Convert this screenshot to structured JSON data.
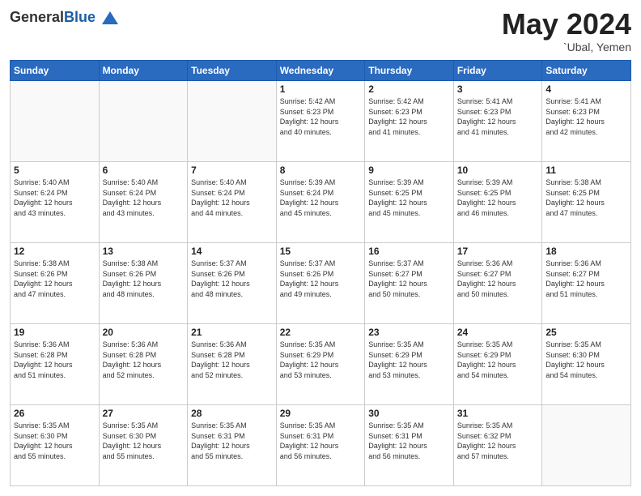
{
  "header": {
    "logo_general": "General",
    "logo_blue": "Blue",
    "month_title": "May 2024",
    "location": "`Ubal, Yemen"
  },
  "weekdays": [
    "Sunday",
    "Monday",
    "Tuesday",
    "Wednesday",
    "Thursday",
    "Friday",
    "Saturday"
  ],
  "weeks": [
    [
      {
        "day": "",
        "info": ""
      },
      {
        "day": "",
        "info": ""
      },
      {
        "day": "",
        "info": ""
      },
      {
        "day": "1",
        "info": "Sunrise: 5:42 AM\nSunset: 6:23 PM\nDaylight: 12 hours\nand 40 minutes."
      },
      {
        "day": "2",
        "info": "Sunrise: 5:42 AM\nSunset: 6:23 PM\nDaylight: 12 hours\nand 41 minutes."
      },
      {
        "day": "3",
        "info": "Sunrise: 5:41 AM\nSunset: 6:23 PM\nDaylight: 12 hours\nand 41 minutes."
      },
      {
        "day": "4",
        "info": "Sunrise: 5:41 AM\nSunset: 6:23 PM\nDaylight: 12 hours\nand 42 minutes."
      }
    ],
    [
      {
        "day": "5",
        "info": "Sunrise: 5:40 AM\nSunset: 6:24 PM\nDaylight: 12 hours\nand 43 minutes."
      },
      {
        "day": "6",
        "info": "Sunrise: 5:40 AM\nSunset: 6:24 PM\nDaylight: 12 hours\nand 43 minutes."
      },
      {
        "day": "7",
        "info": "Sunrise: 5:40 AM\nSunset: 6:24 PM\nDaylight: 12 hours\nand 44 minutes."
      },
      {
        "day": "8",
        "info": "Sunrise: 5:39 AM\nSunset: 6:24 PM\nDaylight: 12 hours\nand 45 minutes."
      },
      {
        "day": "9",
        "info": "Sunrise: 5:39 AM\nSunset: 6:25 PM\nDaylight: 12 hours\nand 45 minutes."
      },
      {
        "day": "10",
        "info": "Sunrise: 5:39 AM\nSunset: 6:25 PM\nDaylight: 12 hours\nand 46 minutes."
      },
      {
        "day": "11",
        "info": "Sunrise: 5:38 AM\nSunset: 6:25 PM\nDaylight: 12 hours\nand 47 minutes."
      }
    ],
    [
      {
        "day": "12",
        "info": "Sunrise: 5:38 AM\nSunset: 6:26 PM\nDaylight: 12 hours\nand 47 minutes."
      },
      {
        "day": "13",
        "info": "Sunrise: 5:38 AM\nSunset: 6:26 PM\nDaylight: 12 hours\nand 48 minutes."
      },
      {
        "day": "14",
        "info": "Sunrise: 5:37 AM\nSunset: 6:26 PM\nDaylight: 12 hours\nand 48 minutes."
      },
      {
        "day": "15",
        "info": "Sunrise: 5:37 AM\nSunset: 6:26 PM\nDaylight: 12 hours\nand 49 minutes."
      },
      {
        "day": "16",
        "info": "Sunrise: 5:37 AM\nSunset: 6:27 PM\nDaylight: 12 hours\nand 50 minutes."
      },
      {
        "day": "17",
        "info": "Sunrise: 5:36 AM\nSunset: 6:27 PM\nDaylight: 12 hours\nand 50 minutes."
      },
      {
        "day": "18",
        "info": "Sunrise: 5:36 AM\nSunset: 6:27 PM\nDaylight: 12 hours\nand 51 minutes."
      }
    ],
    [
      {
        "day": "19",
        "info": "Sunrise: 5:36 AM\nSunset: 6:28 PM\nDaylight: 12 hours\nand 51 minutes."
      },
      {
        "day": "20",
        "info": "Sunrise: 5:36 AM\nSunset: 6:28 PM\nDaylight: 12 hours\nand 52 minutes."
      },
      {
        "day": "21",
        "info": "Sunrise: 5:36 AM\nSunset: 6:28 PM\nDaylight: 12 hours\nand 52 minutes."
      },
      {
        "day": "22",
        "info": "Sunrise: 5:35 AM\nSunset: 6:29 PM\nDaylight: 12 hours\nand 53 minutes."
      },
      {
        "day": "23",
        "info": "Sunrise: 5:35 AM\nSunset: 6:29 PM\nDaylight: 12 hours\nand 53 minutes."
      },
      {
        "day": "24",
        "info": "Sunrise: 5:35 AM\nSunset: 6:29 PM\nDaylight: 12 hours\nand 54 minutes."
      },
      {
        "day": "25",
        "info": "Sunrise: 5:35 AM\nSunset: 6:30 PM\nDaylight: 12 hours\nand 54 minutes."
      }
    ],
    [
      {
        "day": "26",
        "info": "Sunrise: 5:35 AM\nSunset: 6:30 PM\nDaylight: 12 hours\nand 55 minutes."
      },
      {
        "day": "27",
        "info": "Sunrise: 5:35 AM\nSunset: 6:30 PM\nDaylight: 12 hours\nand 55 minutes."
      },
      {
        "day": "28",
        "info": "Sunrise: 5:35 AM\nSunset: 6:31 PM\nDaylight: 12 hours\nand 55 minutes."
      },
      {
        "day": "29",
        "info": "Sunrise: 5:35 AM\nSunset: 6:31 PM\nDaylight: 12 hours\nand 56 minutes."
      },
      {
        "day": "30",
        "info": "Sunrise: 5:35 AM\nSunset: 6:31 PM\nDaylight: 12 hours\nand 56 minutes."
      },
      {
        "day": "31",
        "info": "Sunrise: 5:35 AM\nSunset: 6:32 PM\nDaylight: 12 hours\nand 57 minutes."
      },
      {
        "day": "",
        "info": ""
      }
    ]
  ]
}
